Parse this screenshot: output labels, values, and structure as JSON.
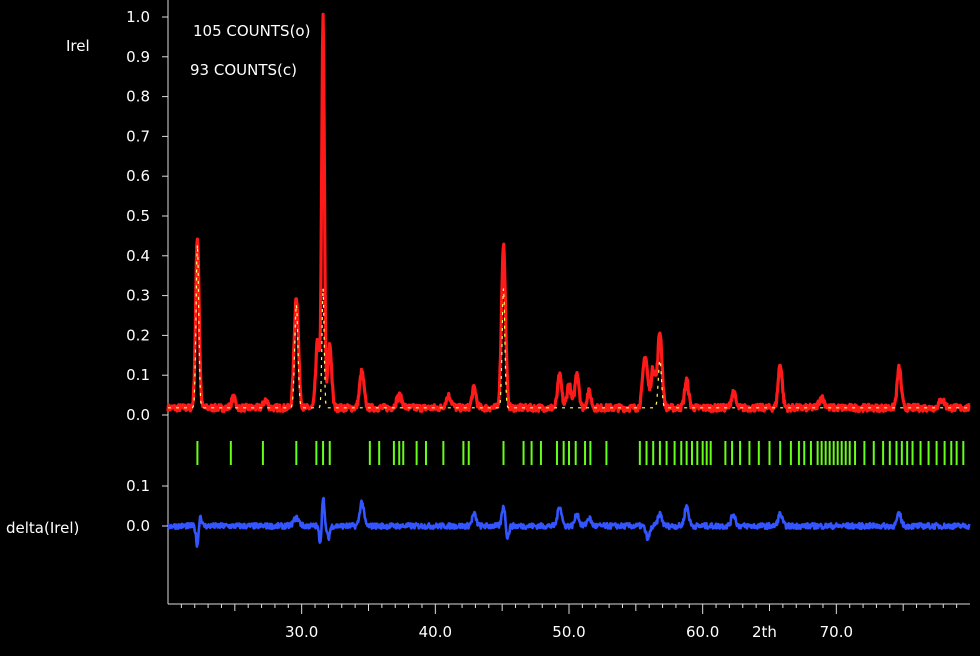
{
  "chart_data": {
    "type": "line",
    "ylabel": "Irel",
    "xlabel": "2th",
    "annotations": [
      "105 COUNTS(o)",
      "93 COUNTS(c)"
    ],
    "xlim": [
      20.0,
      80.0
    ],
    "ylim": [
      0.0,
      1.0
    ],
    "y_ticks": [
      "0.0",
      "0.1",
      "0.2",
      "0.3",
      "0.4",
      "0.5",
      "0.6",
      "0.7",
      "0.8",
      "0.9",
      "1.0"
    ],
    "x_ticks": [
      "30.0",
      "40.0",
      "50.0",
      "60.0",
      "70.0"
    ],
    "diff_label": "delta(Irel)",
    "diff_ticks": [
      "0.1",
      "0.0"
    ],
    "diff_ylim": [
      -0.12,
      0.12
    ],
    "background": 0.018,
    "observed": {
      "name": "observed",
      "color": "#ff1a1a",
      "peaks": [
        [
          22.2,
          0.43,
          0.13
        ],
        [
          24.9,
          0.025,
          0.15
        ],
        [
          27.3,
          0.02,
          0.15
        ],
        [
          29.6,
          0.28,
          0.16
        ],
        [
          31.2,
          0.17,
          0.14
        ],
        [
          31.6,
          0.98,
          0.1
        ],
        [
          32.1,
          0.16,
          0.14
        ],
        [
          34.5,
          0.09,
          0.16
        ],
        [
          37.3,
          0.03,
          0.2
        ],
        [
          41.0,
          0.03,
          0.2
        ],
        [
          42.9,
          0.05,
          0.15
        ],
        [
          45.1,
          0.41,
          0.15
        ],
        [
          49.3,
          0.08,
          0.15
        ],
        [
          50.0,
          0.06,
          0.15
        ],
        [
          50.6,
          0.09,
          0.15
        ],
        [
          51.5,
          0.04,
          0.15
        ],
        [
          55.7,
          0.13,
          0.18
        ],
        [
          56.3,
          0.1,
          0.16
        ],
        [
          56.8,
          0.19,
          0.16
        ],
        [
          58.8,
          0.07,
          0.15
        ],
        [
          62.3,
          0.04,
          0.15
        ],
        [
          65.8,
          0.11,
          0.15
        ],
        [
          68.9,
          0.025,
          0.2
        ],
        [
          74.7,
          0.1,
          0.15
        ],
        [
          77.9,
          0.02,
          0.2
        ]
      ]
    },
    "calculated": {
      "name": "calculated",
      "color": "#ffff66",
      "peaks": [
        [
          22.2,
          0.41,
          0.1
        ],
        [
          29.6,
          0.26,
          0.12
        ],
        [
          31.6,
          0.3,
          0.08
        ],
        [
          45.1,
          0.3,
          0.1
        ],
        [
          56.8,
          0.12,
          0.12
        ]
      ]
    },
    "bragg_positions": {
      "color": "#66ff1a",
      "values": [
        22.2,
        24.7,
        27.1,
        29.6,
        31.1,
        31.6,
        32.1,
        35.1,
        35.8,
        36.9,
        37.3,
        37.6,
        38.6,
        39.3,
        40.6,
        42.1,
        42.5,
        45.1,
        46.6,
        47.2,
        47.9,
        49.1,
        49.6,
        50.0,
        50.5,
        51.2,
        51.6,
        52.8,
        55.3,
        55.8,
        56.3,
        56.8,
        57.3,
        57.9,
        58.4,
        58.8,
        59.2,
        59.6,
        60.0,
        60.3,
        60.6,
        61.7,
        62.2,
        62.8,
        63.5,
        64.2,
        65.0,
        65.8,
        66.6,
        67.2,
        67.6,
        68.1,
        68.6,
        68.9,
        69.2,
        69.5,
        69.8,
        70.1,
        70.4,
        70.7,
        71.0,
        71.4,
        72.1,
        72.8,
        73.5,
        74.0,
        74.5,
        74.9,
        75.3,
        75.7,
        76.3,
        76.9,
        77.5,
        78.1,
        78.6,
        79.0,
        79.5
      ]
    },
    "difference": {
      "name": "difference",
      "color": "#3355ff",
      "features": [
        [
          22.2,
          -0.05,
          0.1
        ],
        [
          22.4,
          0.03,
          0.1
        ],
        [
          29.6,
          0.02,
          0.2
        ],
        [
          31.4,
          -0.04,
          0.1
        ],
        [
          31.6,
          0.08,
          0.08
        ],
        [
          32.0,
          -0.03,
          0.1
        ],
        [
          34.5,
          0.06,
          0.15
        ],
        [
          42.9,
          0.03,
          0.15
        ],
        [
          45.1,
          0.05,
          0.12
        ],
        [
          45.4,
          -0.03,
          0.1
        ],
        [
          49.3,
          0.05,
          0.15
        ],
        [
          50.6,
          0.03,
          0.15
        ],
        [
          51.5,
          0.02,
          0.15
        ],
        [
          55.9,
          -0.03,
          0.15
        ],
        [
          56.8,
          0.03,
          0.15
        ],
        [
          58.8,
          0.05,
          0.15
        ],
        [
          62.3,
          0.03,
          0.15
        ],
        [
          65.8,
          0.03,
          0.15
        ],
        [
          74.7,
          0.03,
          0.15
        ]
      ]
    },
    "grid": false,
    "legend": "none"
  }
}
